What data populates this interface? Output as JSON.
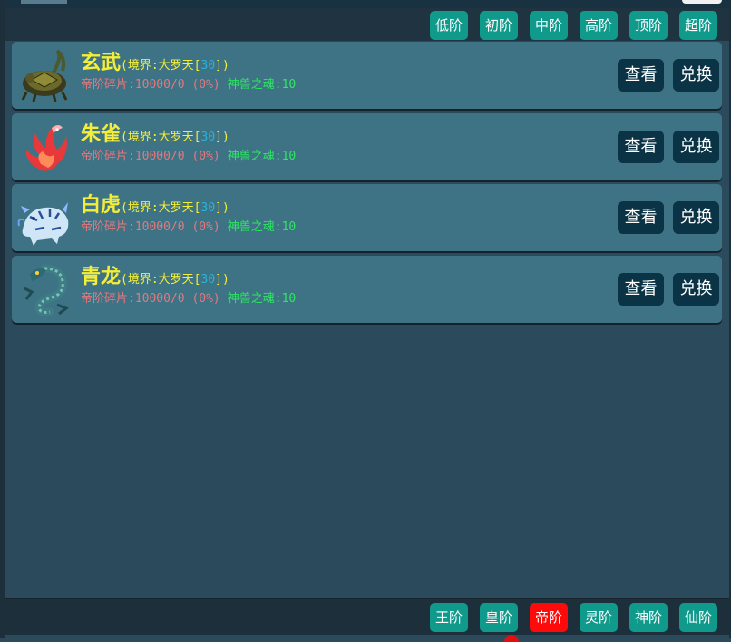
{
  "top_filters": [
    "低阶",
    "初阶",
    "中阶",
    "高阶",
    "顶阶",
    "超阶"
  ],
  "beasts": [
    {
      "name": "玄武",
      "realm_prefix": "(境界:大罗天[",
      "realm_level": "30",
      "realm_suffix": "])",
      "fragments": "帝阶碎片:10000/0 (0%)",
      "soul": "神兽之魂:10",
      "icon": "turtle-snake"
    },
    {
      "name": "朱雀",
      "realm_prefix": "(境界:大罗天[",
      "realm_level": "30",
      "realm_suffix": "])",
      "fragments": "帝阶碎片:10000/0 (0%)",
      "soul": "神兽之魂:10",
      "icon": "phoenix"
    },
    {
      "name": "白虎",
      "realm_prefix": "(境界:大罗天[",
      "realm_level": "30",
      "realm_suffix": "])",
      "fragments": "帝阶碎片:10000/0 (0%)",
      "soul": "神兽之魂:10",
      "icon": "tiger"
    },
    {
      "name": "青龙",
      "realm_prefix": "(境界:大罗天[",
      "realm_level": "30",
      "realm_suffix": "])",
      "fragments": "帝阶碎片:10000/0 (0%)",
      "soul": "神兽之魂:10",
      "icon": "dragon"
    }
  ],
  "actions": {
    "view": "查看",
    "exchange": "兑换"
  },
  "bottom_tabs": [
    "王阶",
    "皇阶",
    "帝阶",
    "灵阶",
    "神阶",
    "仙阶"
  ],
  "active_bottom_tab": "帝阶",
  "colors": {
    "name": "#f4ee3a",
    "realm_level": "#2ab2d8",
    "fragments": "#e4787e",
    "soul": "#2ce860",
    "tier_button": "#0f9a8c",
    "active_tier": "#ff0a0a",
    "action_button": "#0b3346",
    "card": "#3e7385"
  }
}
